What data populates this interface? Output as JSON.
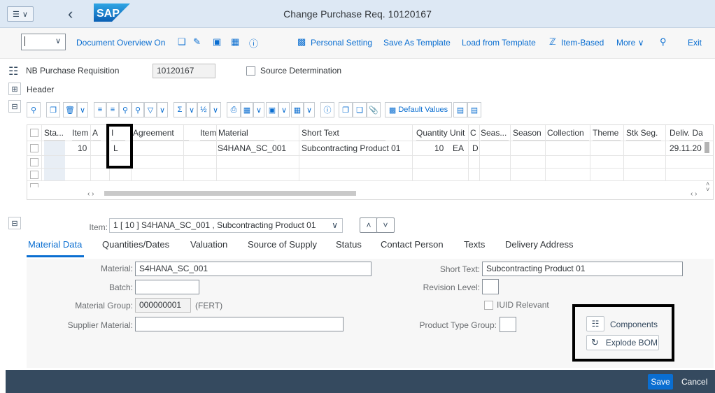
{
  "shell": {
    "title": "Change Purchase Req. 10120167",
    "logo": "SAP"
  },
  "toolbar": {
    "document_overview": "Document Overview On",
    "personal_setting": "Personal Setting",
    "save_as_template": "Save As Template",
    "load_from_template": "Load from Template",
    "item_based": "Item-Based",
    "more": "More",
    "exit": "Exit"
  },
  "header": {
    "doc_type": "NB Purchase Requisition",
    "doc_number": "10120167",
    "source_determination": "Source Determination",
    "header_label": "Header"
  },
  "grid_toolbar": {
    "default_values": "Default Values"
  },
  "table": {
    "columns": [
      "Sta...",
      "Item",
      "A",
      "I",
      "Agreement",
      "Item",
      "Material",
      "Short Text",
      "Quantity",
      "Unit",
      "C",
      "Seas...",
      "Season",
      "Collection",
      "Theme",
      "Stk Seg.",
      "Deliv. Da"
    ],
    "rows": [
      {
        "item": "10",
        "i": "L",
        "material": "S4HANA_SC_001",
        "short_text": "Subcontracting Product 01",
        "quantity": "10",
        "unit": "EA",
        "c": "D",
        "deliv_date": "29.11.20"
      }
    ]
  },
  "item_bar": {
    "label": "Item:",
    "value": "1 [ 10 ] S4HANA_SC_001 , Subcontracting Product 01"
  },
  "tabs": [
    "Material Data",
    "Quantities/Dates",
    "Valuation",
    "Source of Supply",
    "Status",
    "Contact Person",
    "Texts",
    "Delivery Address"
  ],
  "material_data": {
    "material_label": "Material:",
    "material_value": "S4HANA_SC_001",
    "batch_label": "Batch:",
    "batch_value": "",
    "material_group_label": "Material Group:",
    "material_group_value": "000000001",
    "material_group_desc": "(FERT)",
    "supplier_material_label": "Supplier Material:",
    "supplier_material_value": "",
    "short_text_label": "Short Text:",
    "short_text_value": "Subcontracting Product 01",
    "revision_level_label": "Revision Level:",
    "iuid_label": "IUID Relevant",
    "product_type_group_label": "Product Type Group:",
    "components_label": "Components",
    "explode_bom_label": "Explode BOM"
  },
  "footer": {
    "save": "Save",
    "cancel": "Cancel"
  },
  "colors": {
    "accent": "#0a6ed1",
    "shell_bg": "#dde8f4",
    "footer_bg": "#354a5f"
  }
}
